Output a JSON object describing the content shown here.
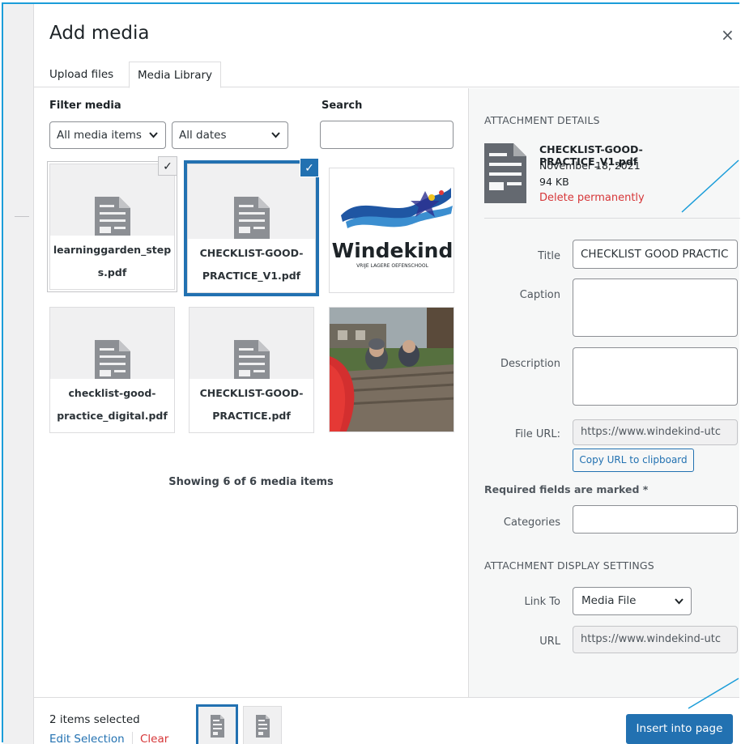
{
  "dialog": {
    "title": "Add media",
    "close_glyph": "×"
  },
  "tabs": [
    {
      "label": "Upload files",
      "active": false
    },
    {
      "label": "Media Library",
      "active": true
    }
  ],
  "filters": {
    "filter_label": "Filter media",
    "type_value": "All media items",
    "date_value": "All dates",
    "search_label": "Search",
    "search_value": ""
  },
  "items": [
    {
      "name": "learninggarden_step\ns.pdf",
      "kind": "document",
      "state": "selected"
    },
    {
      "name": "CHECKLIST-GOOD-\nPRACTICE_V1.pdf",
      "kind": "document",
      "state": "selected-details"
    },
    {
      "name": "",
      "kind": "image-logo",
      "state": "none",
      "logo_text": "Windekind",
      "logo_subtext": "VRIJE LAGERE OEFENSCHOOL"
    },
    {
      "name": "checklist-good-\npractice_digital.pdf",
      "kind": "document",
      "state": "none"
    },
    {
      "name": "CHECKLIST-GOOD-\nPRACTICE.pdf",
      "kind": "document",
      "state": "none"
    },
    {
      "name": "",
      "kind": "image-photo",
      "state": "none"
    }
  ],
  "showing_text": "Showing 6 of 6 media items",
  "details": {
    "heading": "ATTACHMENT DETAILS",
    "filename": "CHECKLIST-GOOD-PRACTICE_V1.pdf",
    "date": "November 18, 2021",
    "size": "94 KB",
    "delete_label": "Delete permanently",
    "fields": {
      "title_label": "Title",
      "title_value": "CHECKLIST GOOD PRACTIC",
      "caption_label": "Caption",
      "description_label": "Description",
      "file_url_label": "File URL:",
      "file_url_value": "https://www.windekind-utc",
      "copy_label": "Copy URL to clipboard",
      "required_note": "Required fields are marked *",
      "categories_label": "Categories"
    },
    "display": {
      "heading": "ATTACHMENT DISPLAY SETTINGS",
      "link_to_label": "Link To",
      "link_to_value": "Media File",
      "url_label": "URL",
      "url_value": "https://www.windekind-utc"
    }
  },
  "footer": {
    "count": "2 items selected",
    "edit": "Edit Selection",
    "clear": "Clear",
    "insert": "Insert into page"
  },
  "icons": {
    "check": "✓",
    "chevron": "❯"
  },
  "colors": {
    "accent": "#2271b1",
    "danger": "#d63638",
    "frame": "#1b9dd9"
  }
}
